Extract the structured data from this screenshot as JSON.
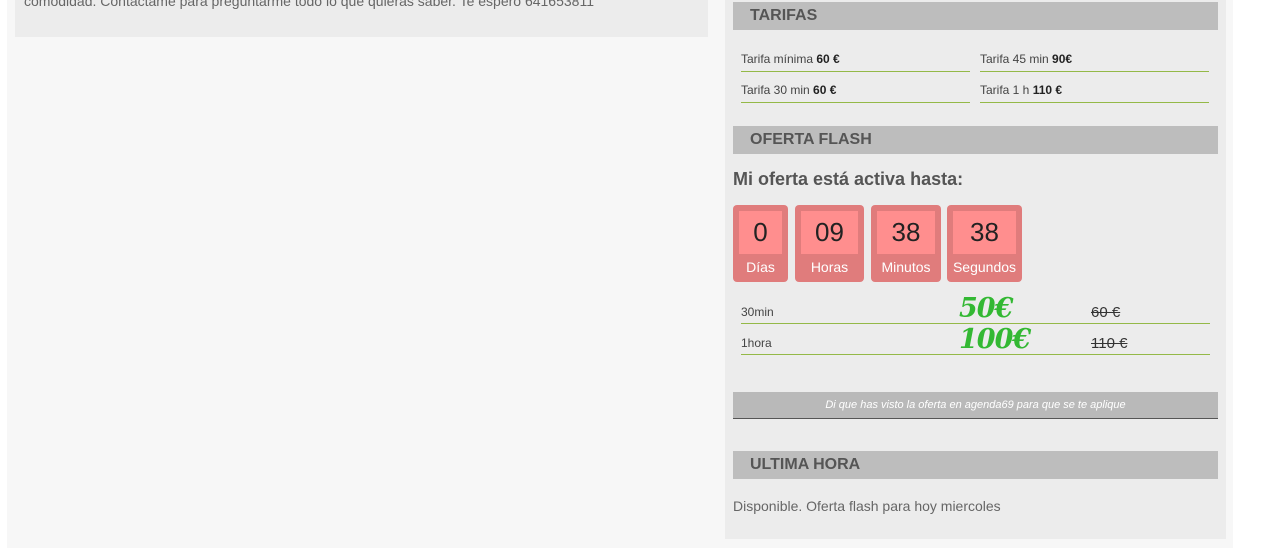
{
  "description": {
    "text": "comodidad. Contáctame para preguntarme todo lo que quieras saber. Te espero 641653811"
  },
  "tarifas": {
    "title": "TARIFAS",
    "items": [
      {
        "label": "Tarifa mínima",
        "price": "60 €"
      },
      {
        "label": "Tarifa 45 min",
        "price": "90€"
      },
      {
        "label": "Tarifa 30 min",
        "price": "60 €"
      },
      {
        "label": "Tarifa 1 h",
        "price": "110 €"
      }
    ]
  },
  "oferta_flash": {
    "title": "OFERTA FLASH",
    "active_until": "Mi oferta está activa hasta:",
    "countdown": [
      {
        "value": "0",
        "label": "Días"
      },
      {
        "value": "09",
        "label": "Horas"
      },
      {
        "value": "38",
        "label": "Minutos"
      },
      {
        "value": "38",
        "label": "Segundos"
      }
    ],
    "offers": [
      {
        "duration": "30min",
        "new_price": "50€",
        "old_price": "60 €"
      },
      {
        "duration": "1hora",
        "new_price": "100€",
        "old_price": "110 €"
      }
    ],
    "notice": "Di que has visto la oferta en agenda69 para que se te aplique"
  },
  "ultima_hora": {
    "title": "ULTIMA HORA",
    "text": "Disponible. Oferta flash para hoy miercoles"
  },
  "colors": {
    "header_bg": "#bdbdbd",
    "countdown_box": "#e07c7c",
    "countdown_num_bg": "#ff8e8e",
    "offer_price": "#33b833",
    "divider": "#94b947"
  }
}
